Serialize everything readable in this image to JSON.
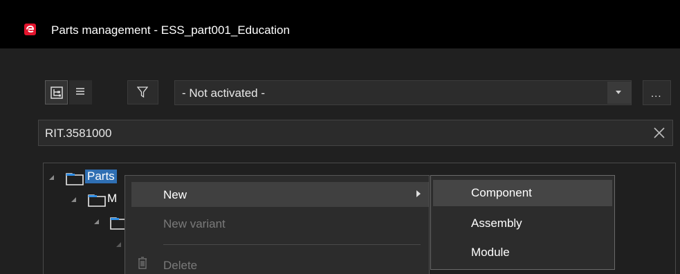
{
  "window": {
    "title": "Parts management - ESS_part001_Education",
    "app_icon": "eplan-logo-icon",
    "accent_color": "#e3142d"
  },
  "toolbar": {
    "tree_view_icon": "tree-view-icon",
    "list_view_icon": "list-view-icon",
    "filter_icon": "filter-icon",
    "filter_combo_value": "- Not activated -",
    "more_label": "..."
  },
  "search": {
    "value": "RIT.3581000",
    "clear_icon": "close-icon"
  },
  "tree": {
    "items": [
      {
        "label": "Parts",
        "selected": true
      },
      {
        "label": "M"
      }
    ]
  },
  "context_menu": {
    "items": [
      {
        "label": "New",
        "enabled": true,
        "has_submenu": true
      },
      {
        "label": "New variant",
        "enabled": false
      },
      {
        "label": "Delete",
        "enabled": false,
        "icon": "trash-icon"
      }
    ]
  },
  "submenu": {
    "items": [
      {
        "label": "Component",
        "highlighted": true
      },
      {
        "label": "Assembly"
      },
      {
        "label": "Module"
      }
    ]
  }
}
